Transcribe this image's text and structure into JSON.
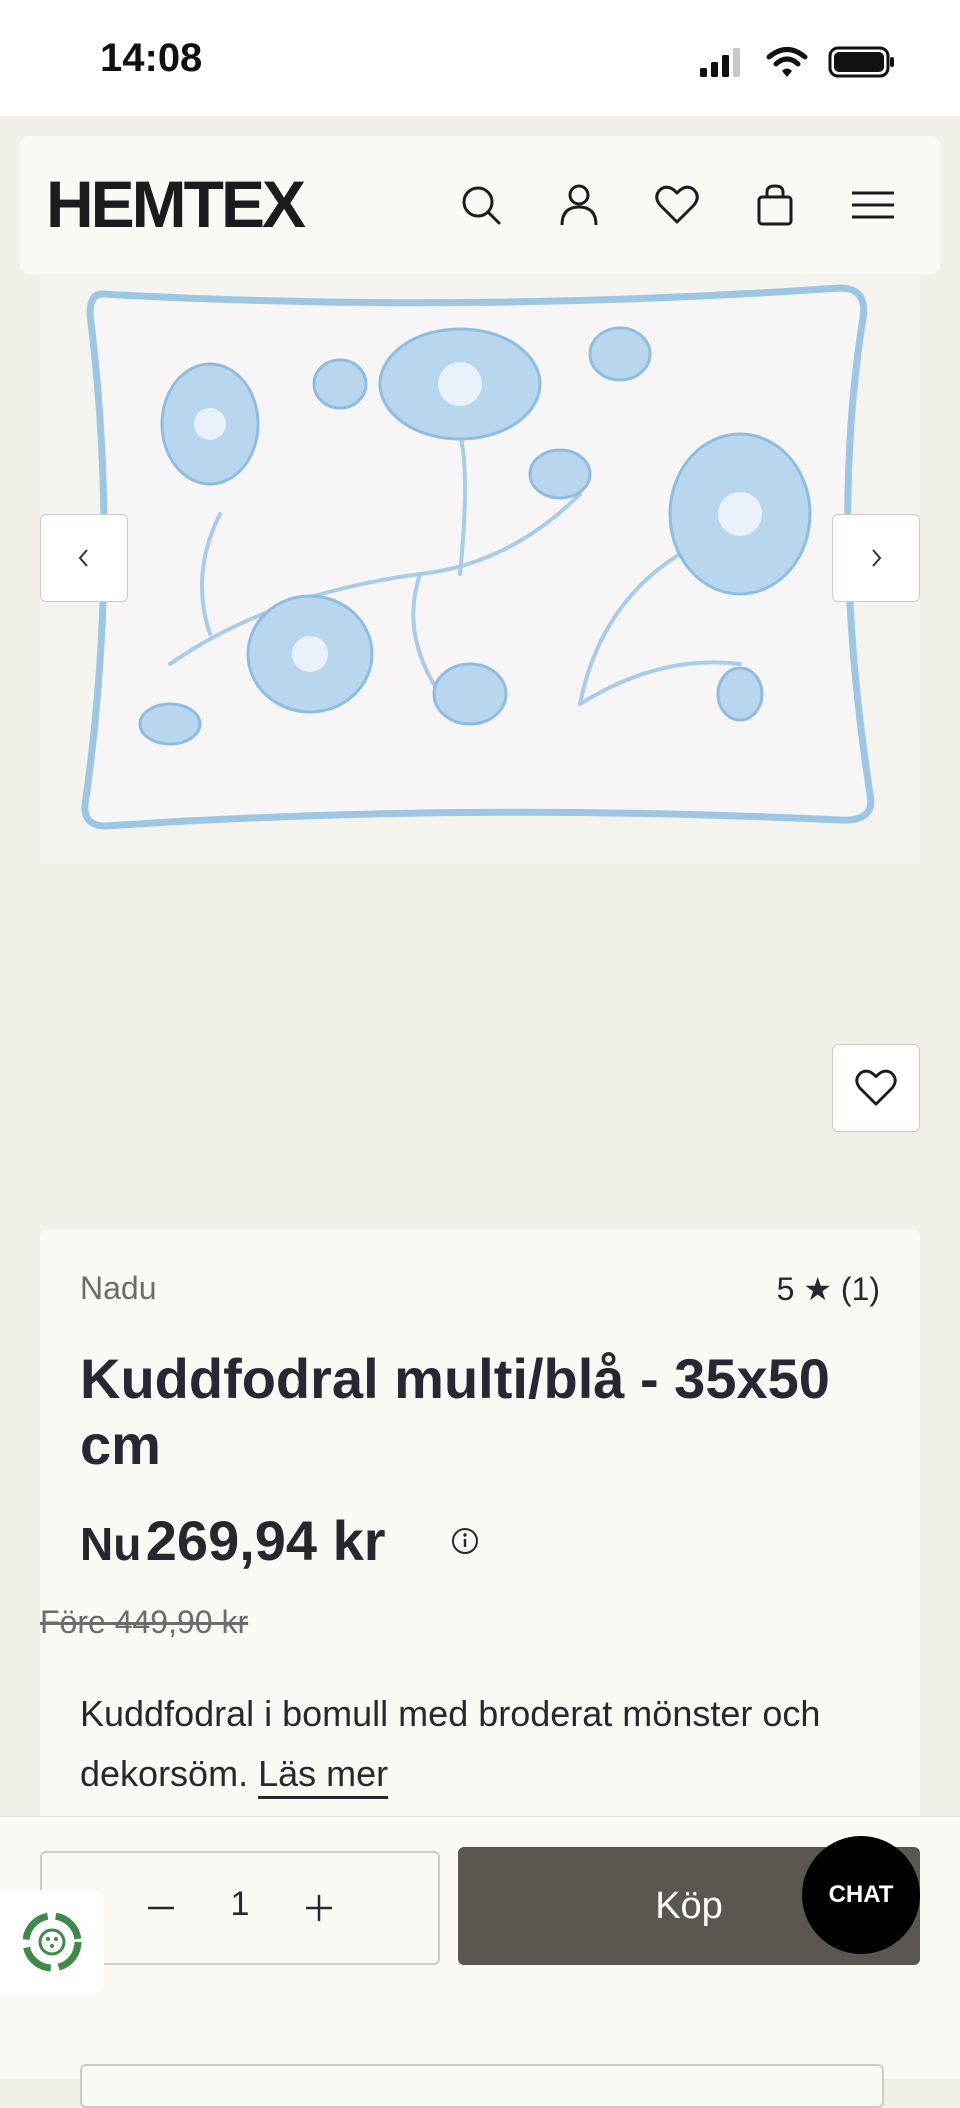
{
  "status_bar": {
    "time": "14:08"
  },
  "header": {
    "logo": "HEMTEX"
  },
  "product": {
    "brand": "Nadu",
    "rating": "5 ★ (1)",
    "title": "Kuddfodral multi/blå - 35x50 cm",
    "price_prefix": "Nu",
    "price_now": "269,94 kr",
    "price_before": "Före 449,90 kr",
    "description": "Kuddfodral i bomull med broderat mönster och dekorsöm.",
    "read_more": "Läs mer"
  },
  "buy_bar": {
    "quantity": "1",
    "buy_label": "Köp"
  },
  "chat": {
    "label": "CHAT"
  },
  "colors": {
    "background": "#f2efe8",
    "card": "#fbf9f4",
    "buy_button": "#5b5650",
    "pillow_embroidery": "#a9cce8"
  }
}
